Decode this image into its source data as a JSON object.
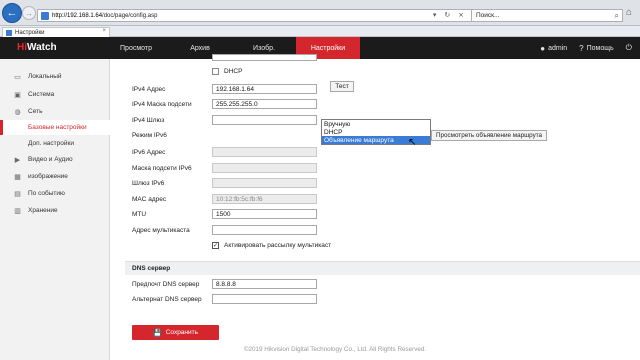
{
  "browser": {
    "url_host": "http://192.168.1.64",
    "url_path": "/doc/page/config.asp",
    "search_placeholder": "Поиск...",
    "tab_title": "Настройки",
    "tab_close": "×",
    "addr_tools": "▾ ↻ ⨯",
    "back_glyph": "←",
    "forward_glyph": "→",
    "search_glyph": "⌕",
    "home_glyph": "⌂"
  },
  "header": {
    "logo_hi": "Hi",
    "logo_rest": "Watch",
    "nav": [
      "Просмотр",
      "Архив",
      "Изобр.",
      "Настройки"
    ],
    "active_nav": "Настройки",
    "user_label": "admin",
    "help_label": "Помощь",
    "user_glyph": "●",
    "help_glyph": "?",
    "logout_glyph": "⏻"
  },
  "sidebar": {
    "items": [
      {
        "label": "Локальный",
        "icon": "monitor-icon",
        "glyph": "▭"
      },
      {
        "label": "Система",
        "icon": "system-icon",
        "glyph": "▣"
      },
      {
        "label": "Сеть",
        "icon": "globe-icon",
        "glyph": "◍"
      },
      {
        "label": "Базовые настройки",
        "icon": "",
        "glyph": ""
      },
      {
        "label": "Доп. настройки",
        "icon": "",
        "glyph": ""
      },
      {
        "label": "Видео и Аудио",
        "icon": "video-icon",
        "glyph": "▶"
      },
      {
        "label": "изображение",
        "icon": "image-icon",
        "glyph": "▦"
      },
      {
        "label": "По событию",
        "icon": "event-icon",
        "glyph": "▤"
      },
      {
        "label": "Хранение",
        "icon": "storage-icon",
        "glyph": "▥"
      }
    ],
    "active_item": "Базовые настройки"
  },
  "form": {
    "dhcp_label": "DHCP",
    "dhcp_checked": false,
    "fields": {
      "ipv4_address": {
        "label": "IPv4 Адрес",
        "value": "192.168.1.64"
      },
      "ipv4_mask": {
        "label": "IPv4 Маска подсети",
        "value": "255.255.255.0"
      },
      "ipv4_gateway": {
        "label": "IPv4 Шлюз",
        "value": ""
      },
      "ipv6_mode": {
        "label": "Режим IPv6",
        "value": ""
      },
      "ipv6_address": {
        "label": "IPv6 Адрес",
        "value": ""
      },
      "ipv6_mask": {
        "label": "Маска подсети IPv6",
        "value": ""
      },
      "ipv6_gateway": {
        "label": "Шлюз IPv6",
        "value": ""
      },
      "mac_address": {
        "label": "MAC адрес",
        "value": "10:12:fb:5c:fb:f6"
      },
      "mtu": {
        "label": "MTU",
        "value": "1500"
      },
      "multicast": {
        "label": "Адрес мультикаста",
        "value": ""
      }
    },
    "test_button": "Тест",
    "ipv6_dropdown": {
      "options": [
        "Вручную",
        "DHCP",
        "Объявление маршрута"
      ],
      "highlighted": "Объявление маршрута"
    },
    "route_button": "Просмотреть объявление маршрута",
    "multicast_discovery_label": "Активировать рассылку мультикаст",
    "multicast_discovery_checked": true,
    "check_glyph": "✓",
    "cursor_glyph": "↖",
    "save_glyph": "💾",
    "dns_section": "DNS сервер",
    "preferred_dns": {
      "label": "Предпочт DNS сервер",
      "value": "8.8.8.8"
    },
    "alternate_dns": {
      "label": "Альтернат DNS сервер",
      "value": ""
    },
    "save_button": "Сохранить"
  },
  "footer": {
    "copyright": "©2019 Hikvision Digital Technology Co., Ltd. All Rights Reserved."
  }
}
